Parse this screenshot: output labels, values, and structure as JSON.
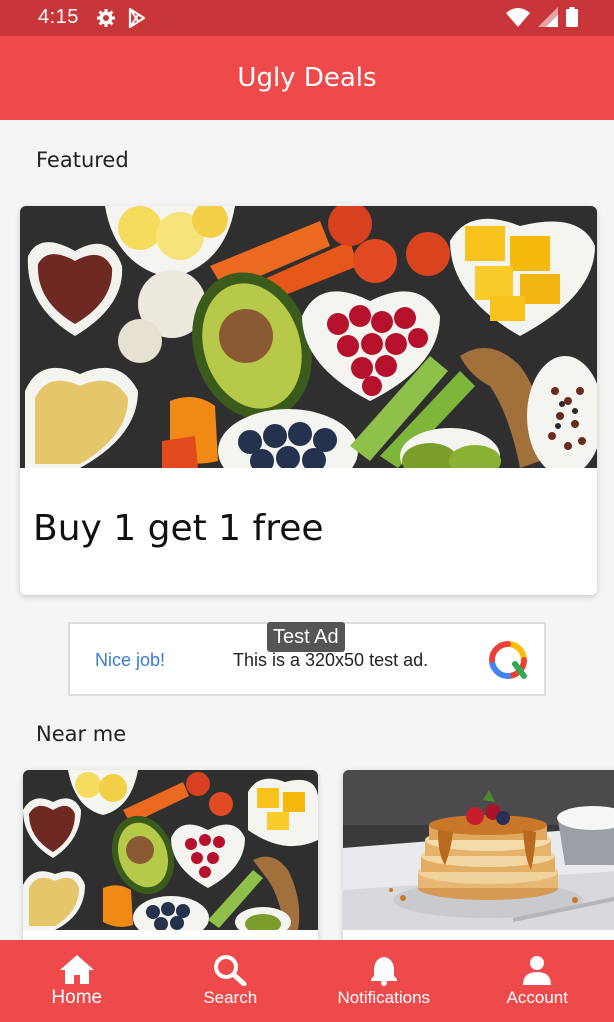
{
  "status_bar": {
    "time": "4:15",
    "icons": [
      "gear-icon",
      "play-store-icon",
      "wifi-icon",
      "signal-icon",
      "battery-icon"
    ]
  },
  "app_bar": {
    "title": "Ugly Deals"
  },
  "featured": {
    "section_title": "Featured",
    "card": {
      "caption": "Buy 1 get 1 free",
      "image": "vegetables-fruits-photo"
    }
  },
  "ad": {
    "label": "Test Ad",
    "nice": "Nice job!",
    "text": "This is a 320x50 test ad."
  },
  "near_me": {
    "section_title": "Near me",
    "cards": [
      {
        "image": "vegetables-fruits-photo"
      },
      {
        "image": "pancakes-photo"
      }
    ]
  },
  "bottom_nav": {
    "items": [
      {
        "label": "Home",
        "icon": "home-icon"
      },
      {
        "label": "Search",
        "icon": "search-icon"
      },
      {
        "label": "Notifications",
        "icon": "bell-icon"
      },
      {
        "label": "Account",
        "icon": "account-icon"
      }
    ]
  },
  "colors": {
    "primary": "#ef4a4b",
    "status_bar": "#c8363a",
    "background": "#f5f5f5"
  }
}
